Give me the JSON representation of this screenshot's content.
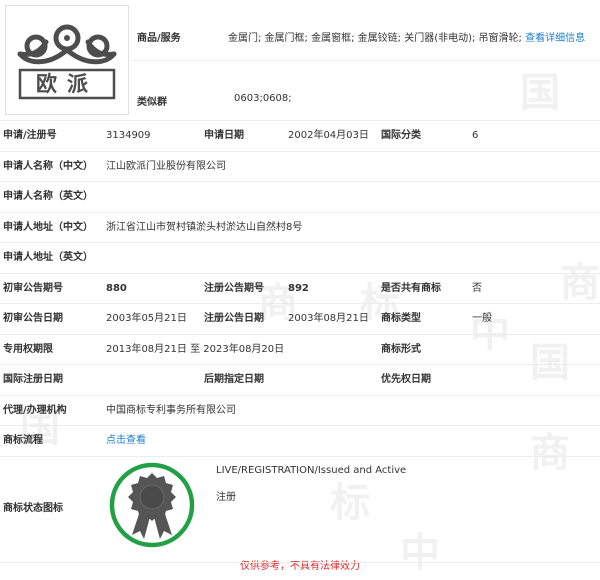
{
  "brand_logo": {
    "text": "欧派"
  },
  "header": {
    "goods_label": "商品/服务",
    "goods_value": "金属门; 金属门框; 金属窗框; 金属铰链; 关门器(非电动); 吊窗滑轮;",
    "goods_link": "查看详细信息",
    "group_label": "类似群",
    "group_value": "0603;0608;"
  },
  "rows": {
    "reg_no_label": "申请/注册号",
    "reg_no": "3134909",
    "apply_date_label": "申请日期",
    "apply_date": "2002年04月03日",
    "intl_class_label": "国际分类",
    "intl_class": "6",
    "applicant_cn_label": "申请人名称（中文）",
    "applicant_cn": "江山欧派门业股份有限公司",
    "applicant_en_label": "申请人名称（英文）",
    "address_cn_label": "申请人地址（中文）",
    "address_cn": "浙江省江山市贺村镇淤头村淤达山自然村8号",
    "address_en_label": "申请人地址（英文）",
    "prelim_no_label": "初审公告期号",
    "prelim_no": "880",
    "reg_pub_no_label": "注册公告期号",
    "reg_pub_no": "892",
    "shared_label": "是否共有商标",
    "shared": "否",
    "prelim_date_label": "初审公告日期",
    "prelim_date": "2003年05月21日",
    "reg_pub_date_label": "注册公告日期",
    "reg_pub_date": "2003年08月21日",
    "type_label": "商标类型",
    "type": "一般",
    "term_label": "专用权期限",
    "term": "2013年08月21日 至 2023年08月20日",
    "form_label": "商标形式",
    "intl_reg_date_label": "国际注册日期",
    "later_date_label": "后期指定日期",
    "priority_date_label": "优先权日期",
    "agent_label": "代理/办理机构",
    "agent": "中国商标专利事务所有限公司",
    "flow_label": "商标流程",
    "flow_link": "点击查看"
  },
  "status": {
    "label": "商标状态图标",
    "status_en": "LIVE/REGISTRATION/Issued and Active",
    "status_cn": "注册",
    "ring_color": "#22a045"
  },
  "disclaimer": "仅供参考，不具有法律效力"
}
